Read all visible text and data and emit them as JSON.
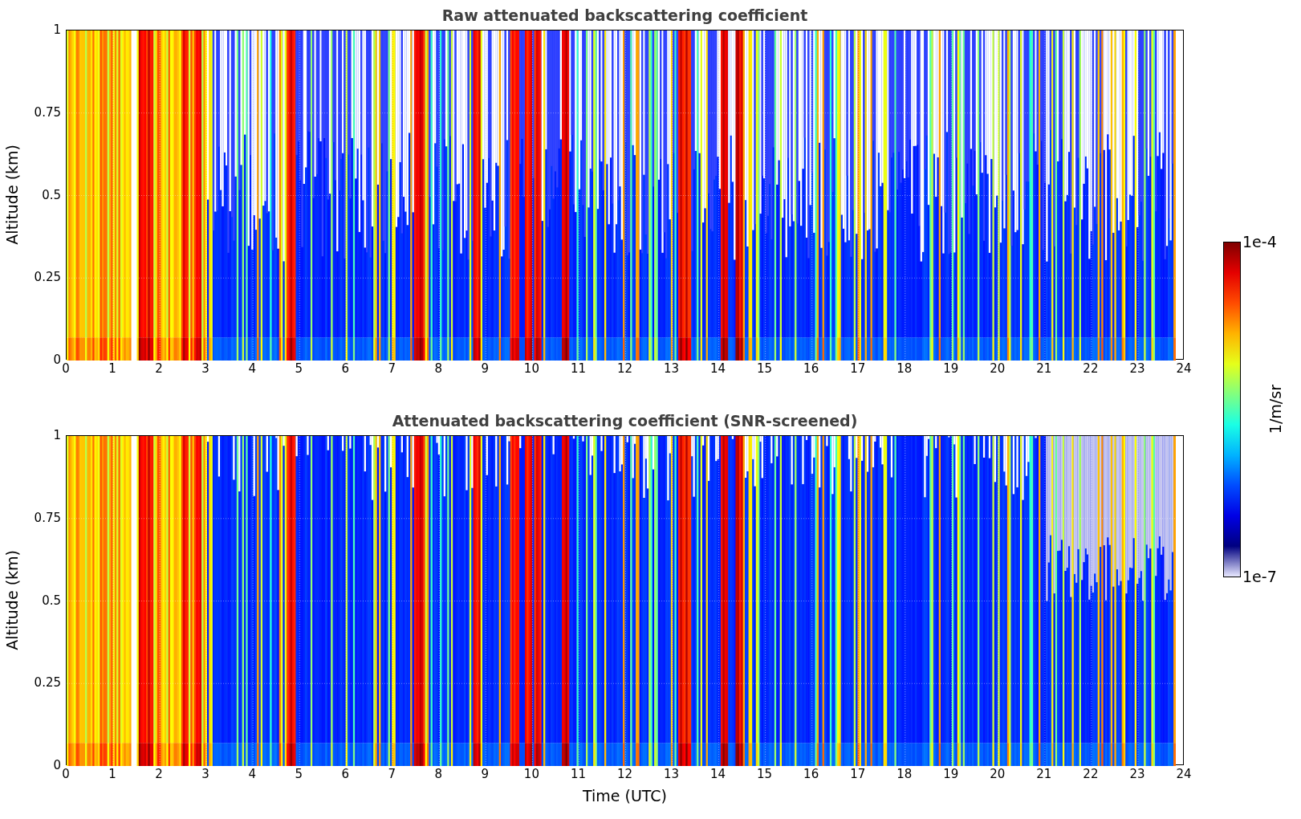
{
  "panels": [
    {
      "kind": "raw",
      "title": "Raw attenuated backscattering coefficient",
      "y_label": "Altitude (km)",
      "y_ticks": [
        "1",
        "0.75",
        "0.5",
        "0.25",
        "0"
      ],
      "x_ticks": [
        "0",
        "1",
        "2",
        "3",
        "4",
        "5",
        "6",
        "7",
        "8",
        "9",
        "10",
        "11",
        "12",
        "13",
        "14",
        "15",
        "16",
        "17",
        "18",
        "19",
        "20",
        "21",
        "22",
        "23",
        "24"
      ]
    },
    {
      "kind": "screened",
      "title": "Attenuated backscattering coefficient (SNR-screened)",
      "y_label": "Altitude (km)",
      "y_ticks": [
        "1",
        "0.75",
        "0.5",
        "0.25",
        "0"
      ],
      "x_ticks": [
        "0",
        "1",
        "2",
        "3",
        "4",
        "5",
        "6",
        "7",
        "8",
        "9",
        "10",
        "11",
        "12",
        "13",
        "14",
        "15",
        "16",
        "17",
        "18",
        "19",
        "20",
        "21",
        "22",
        "23",
        "24"
      ]
    }
  ],
  "x_label": "Time (UTC)",
  "colorbar": {
    "max_label": "1e-4",
    "min_label": "1e-7",
    "unit": "1/m/sr"
  }
}
